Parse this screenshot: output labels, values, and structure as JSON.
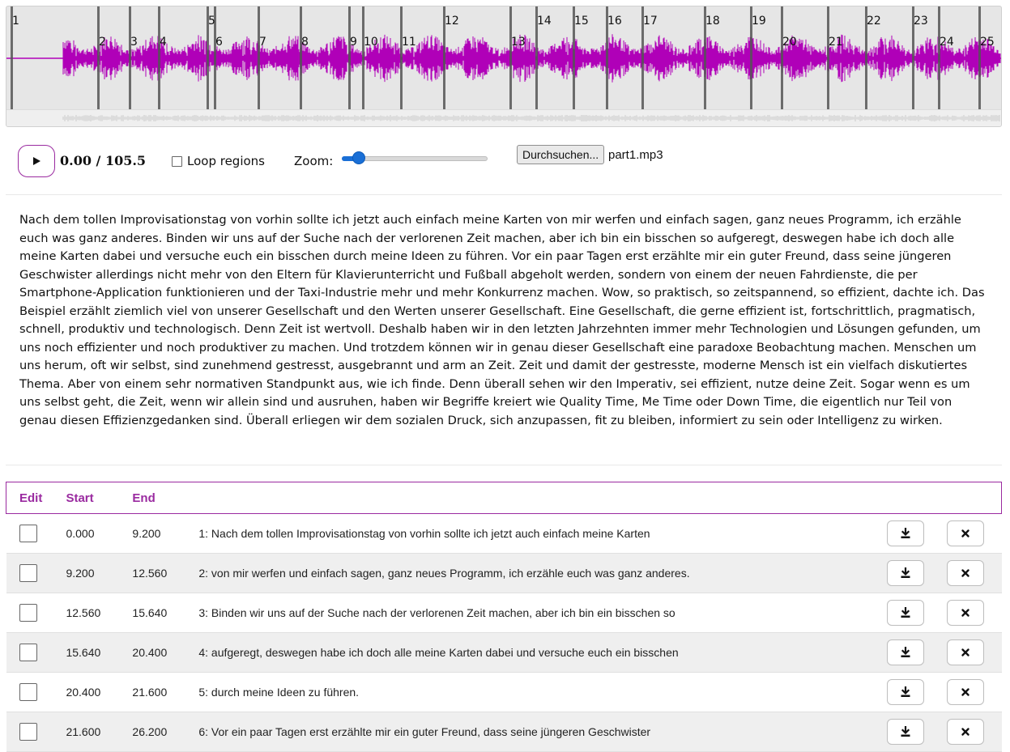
{
  "waveform": {
    "wave_color": "#b000b8",
    "marker_color": "#555555",
    "region_labels": [
      "1",
      "2",
      "3",
      "4",
      "5",
      "6",
      "7",
      "8",
      "9",
      "10",
      "11",
      "12",
      "13",
      "14",
      "15",
      "16",
      "17",
      "18",
      "19",
      "20",
      "21",
      "22",
      "23",
      "24",
      "25"
    ]
  },
  "player": {
    "time": "0.00 / 105.5",
    "loop_label": "Loop regions",
    "zoom_label": "Zoom:",
    "zoom_value": 0.12,
    "file_button_label": "Durchsuchen...",
    "file_name": "part1.mp3"
  },
  "transcript": "Nach dem tollen Improvisationstag von vorhin sollte ich jetzt auch einfach meine Karten von mir werfen und einfach sagen, ganz neues Programm, ich erzähle euch was ganz anderes. Binden wir uns auf der Suche nach der verlorenen Zeit machen, aber ich bin ein bisschen so aufgeregt, deswegen habe ich doch alle meine Karten dabei und versuche euch ein bisschen durch meine Ideen zu führen. Vor ein paar Tagen erst erzählte mir ein guter Freund, dass seine jüngeren Geschwister allerdings nicht mehr von den Eltern für Klavierunterricht und Fußball abgeholt werden, sondern von einem der neuen Fahrdienste, die per Smartphone-Application funktionieren und der Taxi-Industrie mehr und mehr Konkurrenz machen. Wow, so praktisch, so zeitspannend, so effizient, dachte ich. Das Beispiel erzählt ziemlich viel von unserer Gesellschaft und den Werten unserer Gesellschaft. Eine Gesellschaft, die gerne effizient ist, fortschrittlich, pragmatisch, schnell, produktiv und technologisch. Denn Zeit ist wertvoll. Deshalb haben wir in den letzten Jahrzehnten immer mehr Technologien und Lösungen gefunden, um uns noch effizienter und noch produktiver zu machen. Und trotzdem können wir in genau dieser Gesellschaft eine paradoxe Beobachtung machen. Menschen um uns herum, oft wir selbst, sind zunehmend gestresst, ausgebrannt und arm an Zeit. Zeit und damit der gestresste, moderne Mensch ist ein vielfach diskutiertes Thema. Aber von einem sehr normativen Standpunkt aus, wie ich finde. Denn überall sehen wir den Imperativ, sei effizient, nutze deine Zeit. Sogar wenn es um uns selbst geht, die Zeit, wenn wir allein sind und ausruhen, haben wir Begriffe kreiert wie Quality Time, Me Time oder Down Time, die eigentlich nur Teil von genau diesen Effizienzgedanken sind. Überall erliegen wir dem sozialen Druck, sich anzupassen, fit zu bleiben, informiert zu sein oder Intelligenz zu wirken.",
  "table": {
    "headers": {
      "edit": "Edit",
      "start": "Start",
      "end": "End"
    },
    "rows": [
      {
        "start": "0.000",
        "end": "9.200",
        "text": "1: Nach dem tollen Improvisationstag von vorhin sollte ich jetzt auch einfach meine Karten"
      },
      {
        "start": "9.200",
        "end": "12.560",
        "text": "2: von mir werfen und einfach sagen, ganz neues Programm, ich erzähle euch was ganz anderes."
      },
      {
        "start": "12.560",
        "end": "15.640",
        "text": "3: Binden wir uns auf der Suche nach der verlorenen Zeit machen, aber ich bin ein bisschen so"
      },
      {
        "start": "15.640",
        "end": "20.400",
        "text": "4: aufgeregt, deswegen habe ich doch alle meine Karten dabei und versuche euch ein bisschen"
      },
      {
        "start": "20.400",
        "end": "21.600",
        "text": "5: durch meine Ideen zu führen."
      },
      {
        "start": "21.600",
        "end": "26.200",
        "text": "6: Vor ein paar Tagen erst erzählte mir ein guter Freund, dass seine jüngeren Geschwister"
      }
    ],
    "download_icon": "download-icon",
    "delete_icon": "close-icon"
  }
}
